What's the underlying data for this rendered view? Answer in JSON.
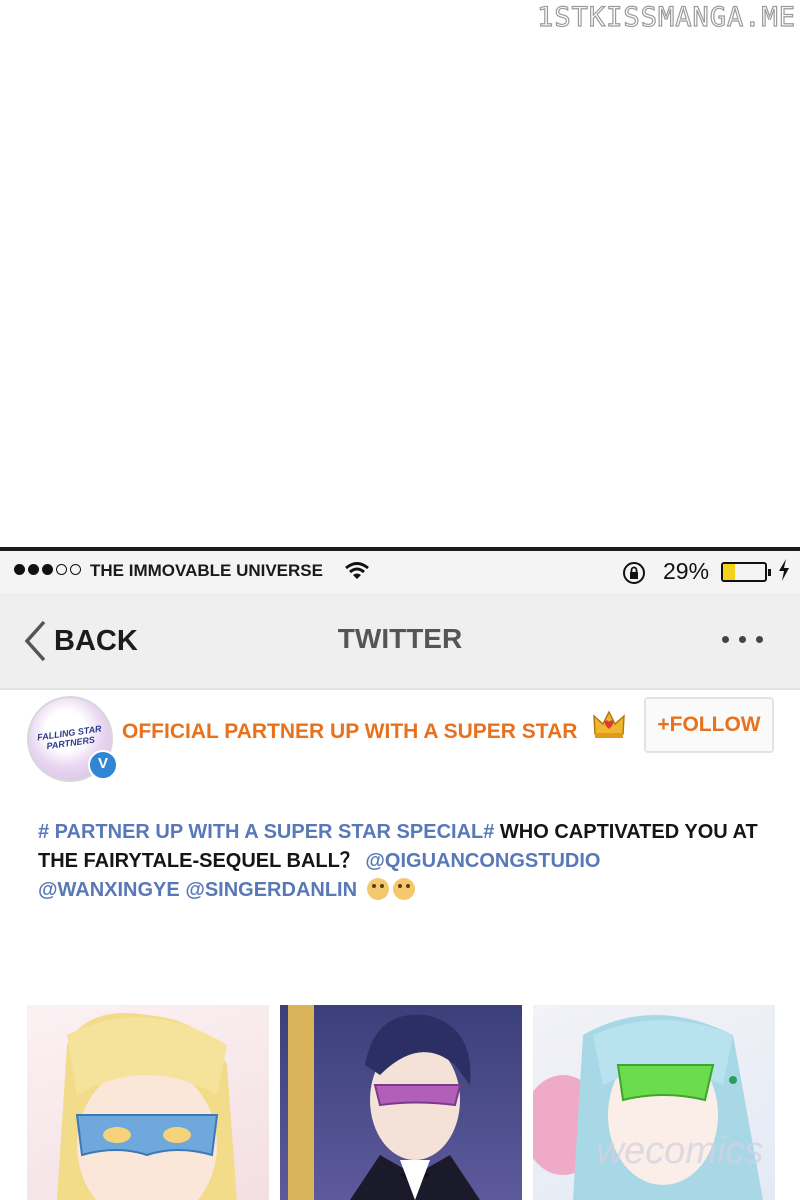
{
  "watermark": "1STKISSMANGA.ME",
  "status_bar": {
    "signal_dots_filled": 3,
    "signal_dots_total": 5,
    "carrier": "THE IMMOVABLE UNIVERSE",
    "battery_percent_text": "29%",
    "battery_level": 0.29,
    "battery_color": "#f4d21b",
    "icons": [
      "wifi-icon",
      "orientation-lock-icon",
      "battery-icon",
      "charging-icon"
    ]
  },
  "nav": {
    "back_label": "BACK",
    "title": "TWITTER",
    "more_icon": "more-dots-icon"
  },
  "post": {
    "account_name": "OFFICIAL PARTNER UP WITH A SUPER STAR",
    "avatar_text": "FALLING STAR PARTNERS",
    "verified_badge": "V",
    "follow_label": "+FOLLOW",
    "hashtag": "# PARTNER UP WITH A SUPER STAR SPECIAL#",
    "text_1": " WHO CAPTIVATED YOU AT THE FAIRYTALE-SEQUEL BALL？ ",
    "mention_1": "@QIGUANCONGSTUDIO",
    "mention_2": "@WANXINGYE",
    "mention_3": "@SINGERDANLIN",
    "accent_color": "#e8711d",
    "link_color": "#5878b8"
  },
  "images_watermark": "wecomics"
}
